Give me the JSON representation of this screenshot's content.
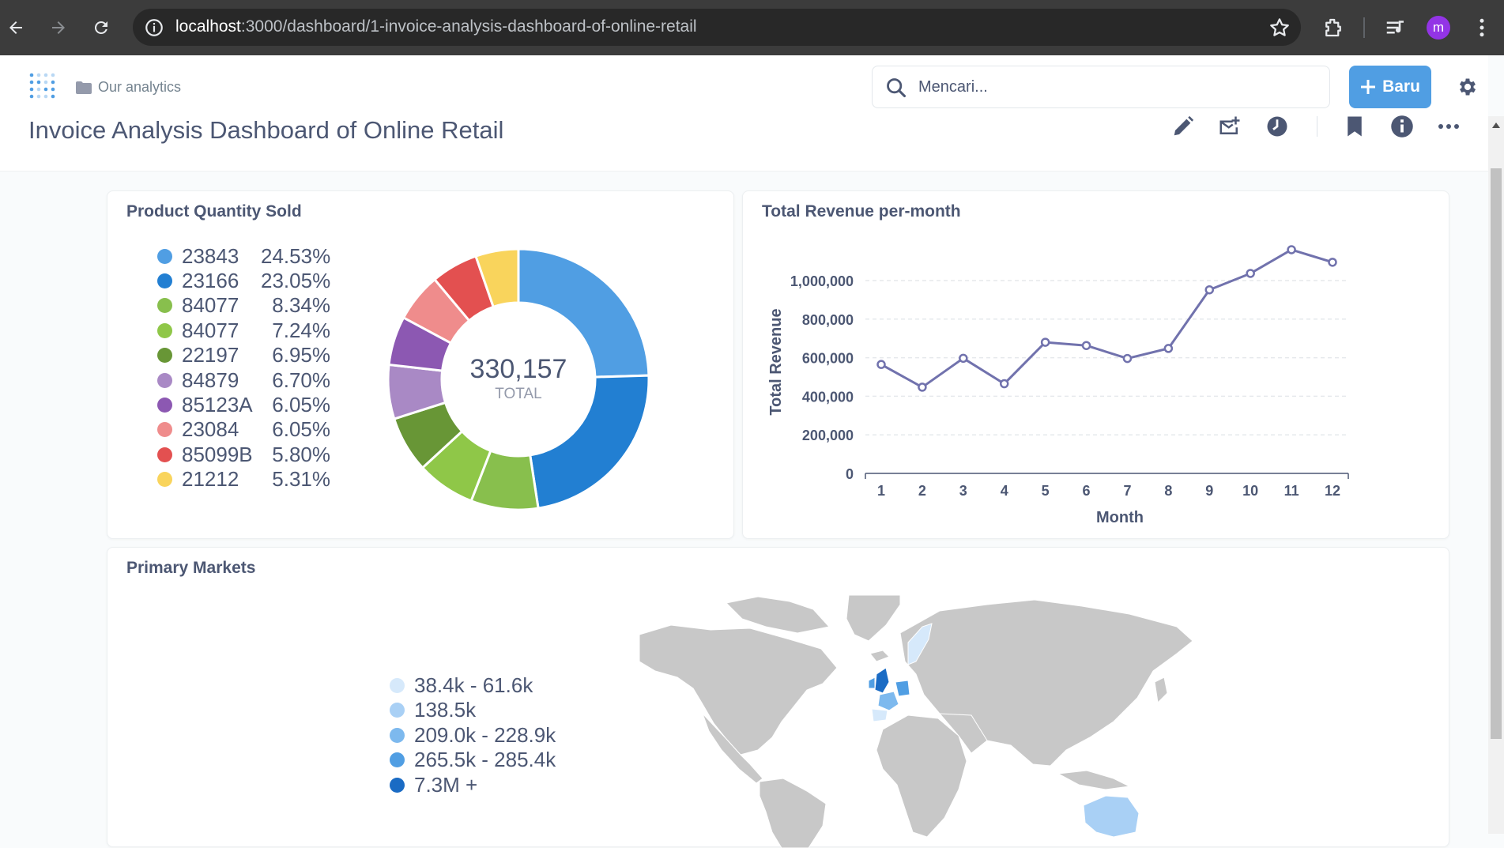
{
  "browser": {
    "url_host": "localhost",
    "url_path": ":3000/dashboard/1-invoice-analysis-dashboard-of-online-retail",
    "profile_initial": "m"
  },
  "header": {
    "breadcrumb": "Our analytics",
    "search_placeholder": "Mencari...",
    "new_label": "Baru"
  },
  "dashboard": {
    "title": "Invoice Analysis Dashboard of Online Retail"
  },
  "colors": {
    "brand": "#509ee3",
    "line": "#7172ad",
    "text": "#4c5773"
  },
  "cards": {
    "product_quantity": {
      "title": "Product Quantity Sold"
    },
    "revenue": {
      "title": "Total Revenue per-month"
    },
    "markets": {
      "title": "Primary Markets"
    }
  },
  "chart_data": [
    {
      "type": "pie",
      "title": "Product Quantity Sold",
      "center_value": "330,157",
      "center_label": "TOTAL",
      "slices": [
        {
          "label": "23843",
          "percent": "24.53%",
          "value": 24.53,
          "color": "#509ee3"
        },
        {
          "label": "23166",
          "percent": "23.05%",
          "value": 23.05,
          "color": "#227fd2"
        },
        {
          "label": "84077",
          "percent": "8.34%",
          "value": 8.34,
          "color": "#88bf4d"
        },
        {
          "label": "84077",
          "percent": "7.24%",
          "value": 7.24,
          "color": "#8fc748"
        },
        {
          "label": "22197",
          "percent": "6.95%",
          "value": 6.95,
          "color": "#689636"
        },
        {
          "label": "84879",
          "percent": "6.70%",
          "value": 6.7,
          "color": "#a989c5"
        },
        {
          "label": "85123A",
          "percent": "6.05%",
          "value": 6.05,
          "color": "#8c58b2"
        },
        {
          "label": "23084",
          "percent": "6.05%",
          "value": 6.05,
          "color": "#ef8c8c"
        },
        {
          "label": "85099B",
          "percent": "5.80%",
          "value": 5.8,
          "color": "#e35050"
        },
        {
          "label": "21212",
          "percent": "5.31%",
          "value": 5.31,
          "color": "#f9d45c"
        }
      ]
    },
    {
      "type": "line",
      "title": "Total Revenue per-month",
      "xlabel": "Month",
      "ylabel": "Total Revenue",
      "x": [
        1,
        2,
        3,
        4,
        5,
        6,
        7,
        8,
        9,
        10,
        11,
        12
      ],
      "x_tick_labels": [
        "1",
        "2",
        "3",
        "4",
        "5",
        "6",
        "7",
        "8",
        "9",
        "10",
        "11",
        "12"
      ],
      "series": [
        {
          "values": [
            565000,
            447000,
            597000,
            465000,
            680000,
            663000,
            596000,
            648000,
            952000,
            1037000,
            1160000,
            1095000
          ]
        }
      ],
      "ylim": [
        0,
        1000000
      ],
      "y_ticks": [
        0,
        200000,
        400000,
        600000,
        800000,
        1000000
      ],
      "y_tick_labels": [
        "0",
        "200,000",
        "400,000",
        "600,000",
        "800,000",
        "1,000,000"
      ],
      "grid": true
    }
  ],
  "map": {
    "legend": [
      {
        "label": "38.4k - 61.6k",
        "color": "#d6e9fb"
      },
      {
        "label": "138.5k",
        "color": "#a9d0f5"
      },
      {
        "label": "209.0k - 228.9k",
        "color": "#7db9ee"
      },
      {
        "label": "265.5k - 285.4k",
        "color": "#509ee3"
      },
      {
        "label": "7.3M +",
        "color": "#1a6bc4"
      }
    ]
  }
}
